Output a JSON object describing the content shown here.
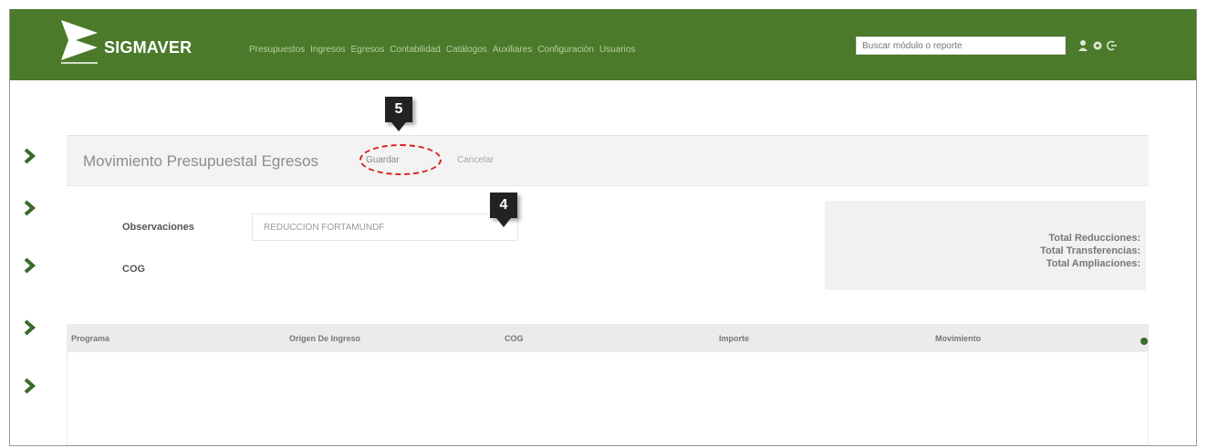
{
  "app": {
    "brand": "SIGMAVER"
  },
  "nav": {
    "items": [
      "Presupuestos",
      "Ingresos",
      "Egresos",
      "Contabilidad",
      "Catálogos",
      "Auxiliares",
      "Configuración",
      "Usuarios"
    ]
  },
  "search": {
    "placeholder": "Buscar módulo o reporte"
  },
  "header_icons": [
    "user-icon",
    "settings-icon",
    "logout-icon"
  ],
  "panel": {
    "title": "Movimiento Presupuestal Egresos",
    "save_label": "Guardar",
    "cancel_label": "Cancelar"
  },
  "callouts": {
    "save": "5",
    "observaciones": "4"
  },
  "form": {
    "observaciones_label": "Observaciones",
    "observaciones_value": "REDUCCIÓN FORTAMUNDF",
    "cog_label": "COG"
  },
  "totals": {
    "reducciones": "Total Reducciones:",
    "transferencias": "Total Transferencias:",
    "ampliaciones": "Total Ampliaciones:"
  },
  "table": {
    "columns": [
      "Programa",
      "Origen De Ingreso",
      "COG",
      "Importe",
      "Movimiento"
    ]
  },
  "colors": {
    "topbar": "#4a7a2a",
    "accent_green": "#3a6a2a",
    "annotation_red": "#d82020"
  }
}
